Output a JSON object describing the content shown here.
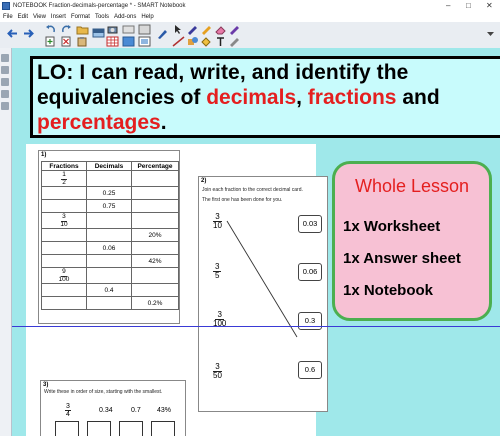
{
  "window": {
    "title": "NOTEBOOK  Fraction-decimals-percentage * - SMART Notebook",
    "minimize": "–",
    "maximize": "□",
    "close": "✕"
  },
  "menu": [
    "File",
    "Edit",
    "View",
    "Insert",
    "Format",
    "Tools",
    "Add-ons",
    "Help"
  ],
  "toolbar_icons": [
    "back-icon",
    "forward-icon",
    "add-page-icon",
    "delete-page-icon",
    "undo-icon",
    "redo-icon",
    "open-icon",
    "save-icon",
    "paste-icon",
    "screen-shade-icon",
    "table-icon",
    "document-camera-icon",
    "pointer-icon",
    "pen-icon",
    "highlighter-icon",
    "eraser-icon",
    "line-icon",
    "shape-icon",
    "text-icon",
    "fill-icon",
    "properties-icon",
    "magic-pen-icon"
  ],
  "lo": {
    "line1": "LO: I can read, write, and identify the",
    "line2_prefix": "equivalencies of  ",
    "decimals": "decimals",
    "comma": ", ",
    "fractions": "fractions",
    "and": " and",
    "percentages": "percentages",
    "period": "."
  },
  "worksheet": {
    "q1": {
      "number": "1)",
      "headers": [
        "Fractions",
        "Decimals",
        "Percentage"
      ],
      "rows": [
        {
          "num": "1",
          "den": "2",
          "decimal": "",
          "percent": ""
        },
        {
          "num": "",
          "den": "",
          "decimal": "0.25",
          "percent": ""
        },
        {
          "num": "",
          "den": "",
          "decimal": "0.75",
          "percent": ""
        },
        {
          "num": "3",
          "den": "10",
          "decimal": "",
          "percent": ""
        },
        {
          "num": "",
          "den": "",
          "decimal": "",
          "percent": "20%"
        },
        {
          "num": "",
          "den": "",
          "decimal": "0.06",
          "percent": ""
        },
        {
          "num": "",
          "den": "",
          "decimal": "",
          "percent": "42%"
        },
        {
          "num": "9",
          "den": "100",
          "decimal": "",
          "percent": ""
        },
        {
          "num": "",
          "den": "",
          "decimal": "0.4",
          "percent": ""
        },
        {
          "num": "",
          "den": "",
          "decimal": "",
          "percent": "0.2%"
        }
      ]
    },
    "q2": {
      "number": "2)",
      "instruction1": "Join each fraction to the correct decimal card.",
      "instruction2": "The first one has been done for you.",
      "fractions": [
        {
          "num": "3",
          "den": "10"
        },
        {
          "num": "3",
          "den": "5"
        },
        {
          "num": "3",
          "den": "100"
        },
        {
          "num": "3",
          "den": "50"
        }
      ],
      "cards": [
        "0.03",
        "0.06",
        "0.3",
        "0.6"
      ]
    },
    "q3": {
      "number": "3)",
      "instruction": "Write these in order of size, starting with the smallest.",
      "values": [
        "0.34",
        "0.7",
        "43%"
      ],
      "fraction": {
        "num": "3",
        "den": "4"
      },
      "smallest_label": "smallest"
    }
  },
  "lesson": {
    "heading": "Whole Lesson",
    "items": [
      "1x Worksheet",
      "1x Answer sheet",
      "1x Notebook"
    ],
    "bg_color": "#f7c1d4",
    "border_color": "#4caf50"
  },
  "colors": {
    "canvas": "#9fe8ea",
    "lo_box": "#c8fbfc",
    "highlight_red": "#e41f1f"
  }
}
